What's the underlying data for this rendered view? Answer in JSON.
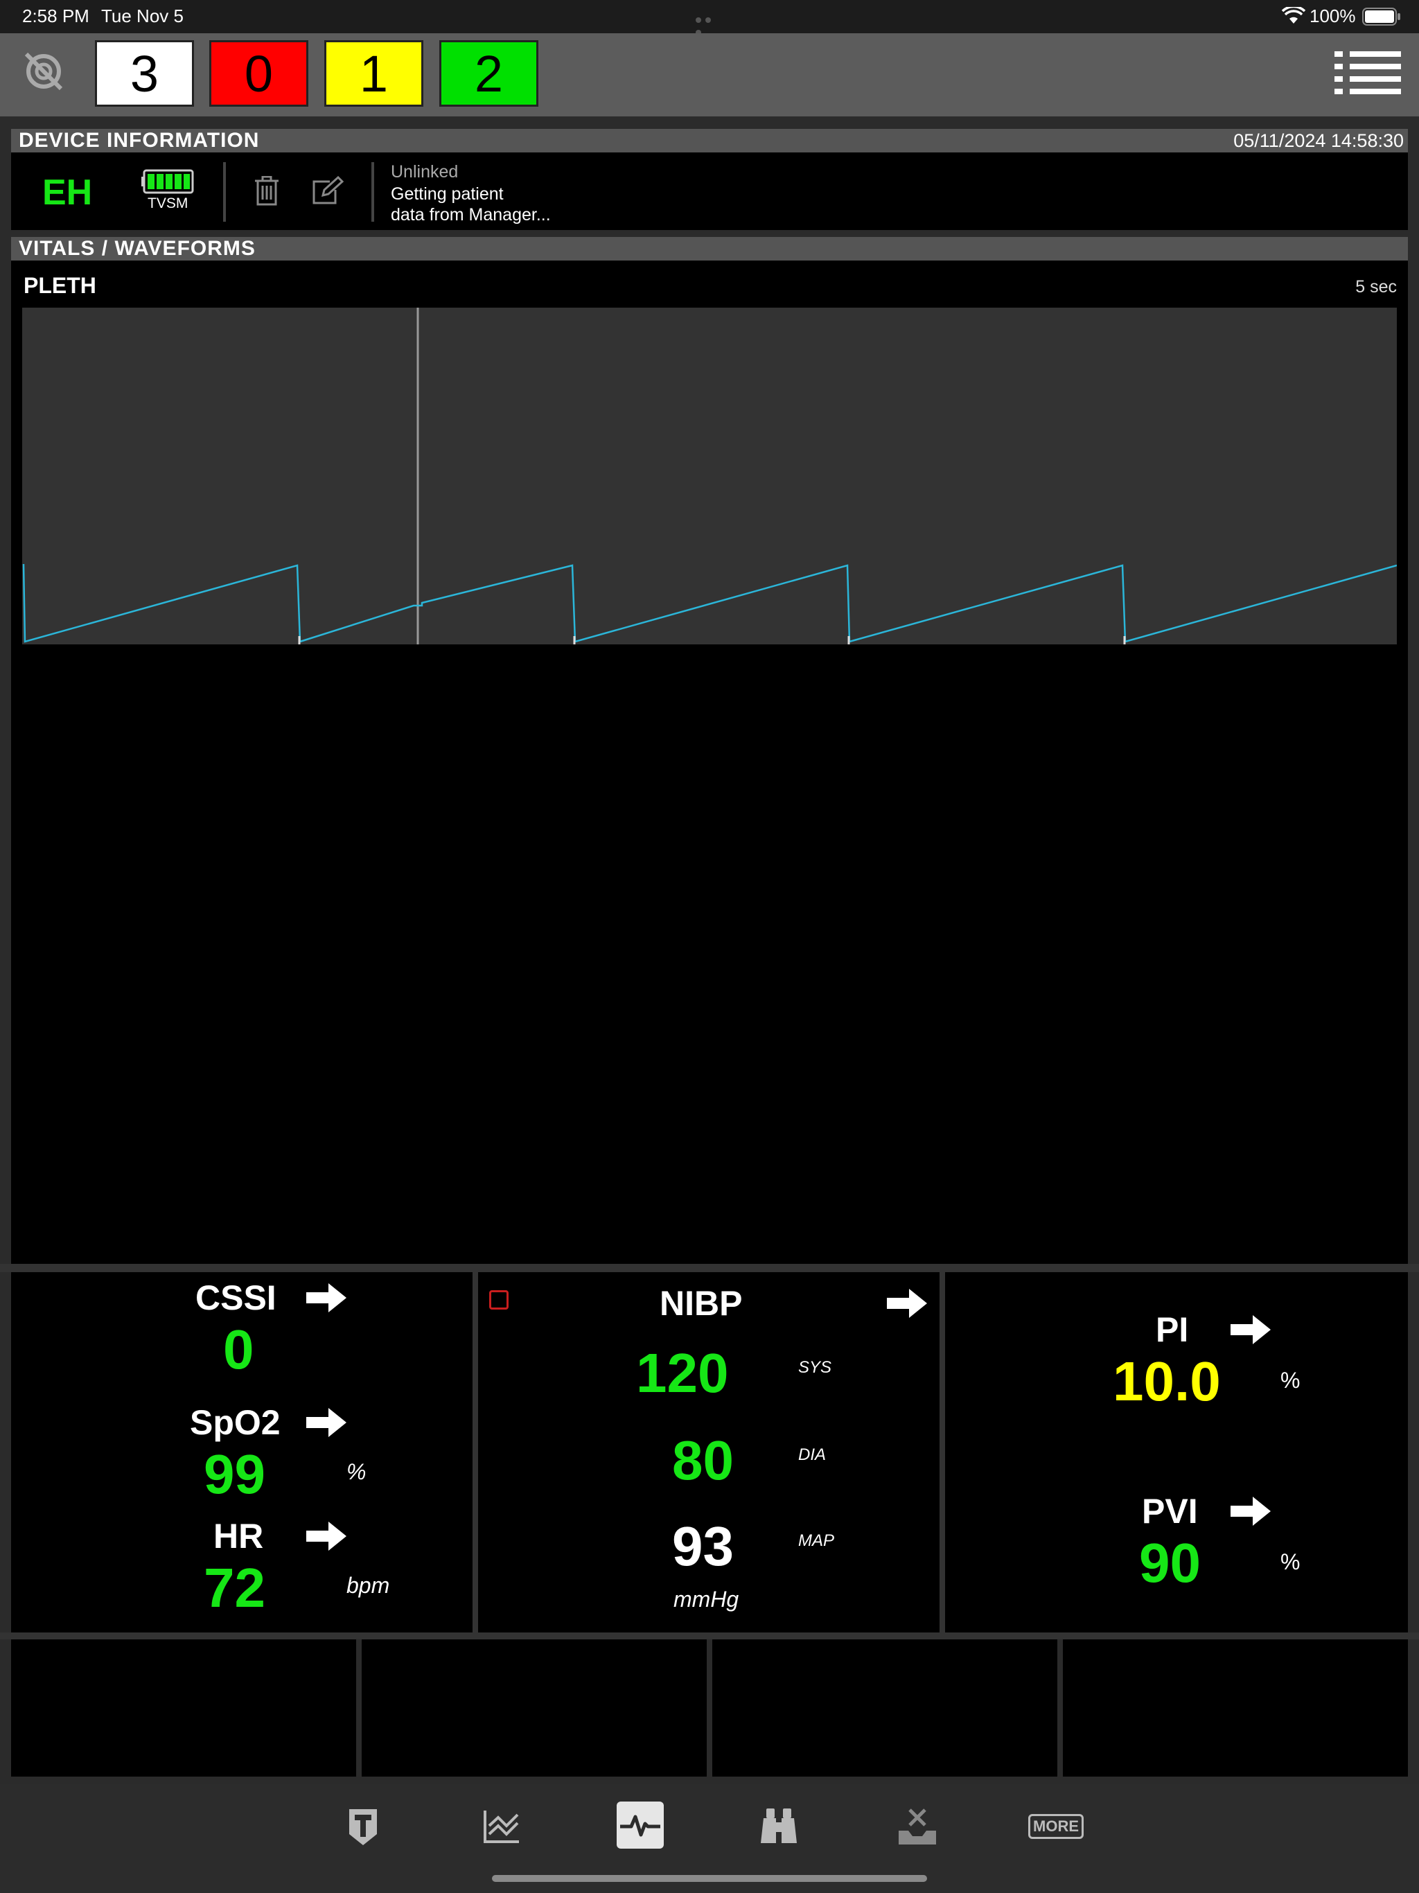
{
  "status_bar": {
    "time": "2:58 PM",
    "date": "Tue Nov 5",
    "battery": "100%"
  },
  "triage_counts": [
    {
      "value": "3",
      "color": "#ffffff"
    },
    {
      "value": "0",
      "color": "#ff0000"
    },
    {
      "value": "1",
      "color": "#ffff00"
    },
    {
      "value": "2",
      "color": "#00e000"
    }
  ],
  "device_info": {
    "header": "DEVICE INFORMATION",
    "timestamp": "05/11/2024 14:58:30",
    "initials": "EH",
    "device_type": "TVSM",
    "link_status": "Unlinked",
    "message_line1": "Getting patient",
    "message_line2": "data from Manager..."
  },
  "vitals": {
    "header": "VITALS / WAVEFORMS",
    "waveform": {
      "label": "PLETH",
      "duration": "5 sec"
    }
  },
  "readings": {
    "cssi": {
      "label": "CSSI",
      "value": "0"
    },
    "spo2": {
      "label": "SpO2",
      "value": "99",
      "unit": "%"
    },
    "hr": {
      "label": "HR",
      "value": "72",
      "unit": "bpm"
    },
    "nibp": {
      "label": "NIBP",
      "sys": "120",
      "sys_label": "SYS",
      "dia": "80",
      "dia_label": "DIA",
      "map": "93",
      "map_label": "MAP",
      "unit": "mmHg"
    },
    "pi": {
      "label": "PI",
      "value": "10.0",
      "unit": "%"
    },
    "pvi": {
      "label": "PVI",
      "value": "90",
      "unit": "%"
    }
  },
  "nav": {
    "items": [
      {
        "icon": "triage-tag-icon"
      },
      {
        "icon": "trend-chart-icon"
      },
      {
        "icon": "waveform-icon",
        "active": true
      },
      {
        "icon": "binoculars-icon"
      },
      {
        "icon": "unlink-device-icon"
      },
      {
        "icon": "more-icon",
        "label": "MORE"
      }
    ]
  },
  "colors": {
    "accent_green": "#16e716",
    "warning_yellow": "#ffff00",
    "waveform": "#2bb6d9"
  }
}
